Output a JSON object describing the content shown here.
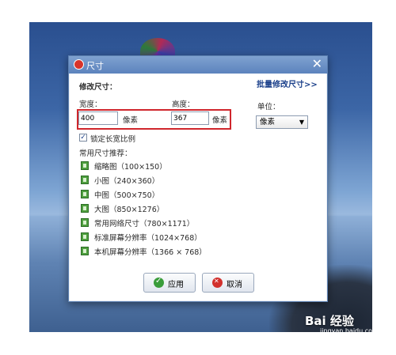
{
  "dialog": {
    "title": "尺寸",
    "close_glyph": "✕",
    "section_label": "修改尺寸：",
    "batch_link": "批量修改尺寸>>",
    "width_label": "宽度：",
    "width_value": "400",
    "width_unit": "像素",
    "height_label": "高度：",
    "height_value": "367",
    "height_unit": "像素",
    "unit_label": "单位：",
    "unit_selected": "像素",
    "lock_ratio_label": "锁定长宽比例",
    "lock_ratio_checked": true,
    "presets_label": "常用尺寸推荐：",
    "presets": [
      "缩略图（100×150）",
      "小图（240×360）",
      "中图（500×750）",
      "大图（850×1276）",
      "常用网络尺寸（780×1171）",
      "标准屏幕分辨率（1024×768）",
      "本机屏幕分辨率（1366 × 768）"
    ],
    "ok_label": "应用",
    "cancel_label": "取消"
  },
  "watermark": {
    "brand": "Bai 经验",
    "sub": "jingyan.baidu.com"
  },
  "colors": {
    "highlight_border": "#d0262c",
    "titlebar": "#5c83bd",
    "link": "#1a3f8a"
  }
}
